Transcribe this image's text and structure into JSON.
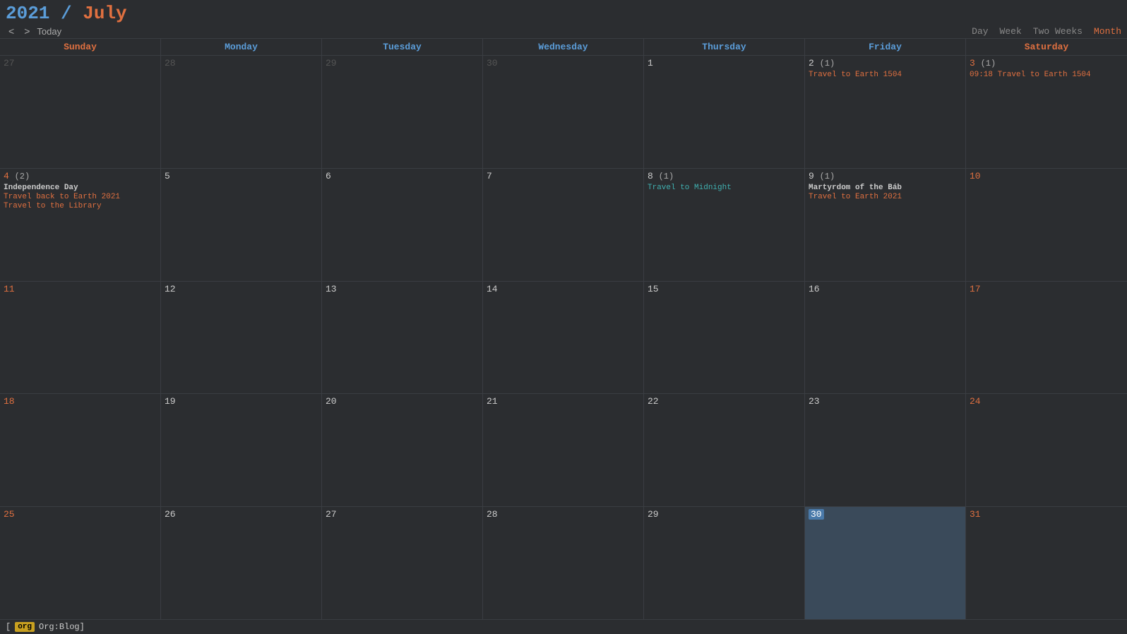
{
  "header": {
    "year": "2021",
    "slash": " / ",
    "month": "July",
    "nav": {
      "prev": "<",
      "next": ">",
      "today": "Today"
    },
    "views": [
      "Day",
      "Week",
      "Two Weeks",
      "Month"
    ],
    "active_view": "Month"
  },
  "day_headers": [
    {
      "label": "Sunday",
      "type": "weekend"
    },
    {
      "label": "Monday",
      "type": "weekday"
    },
    {
      "label": "Tuesday",
      "type": "weekday"
    },
    {
      "label": "Wednesday",
      "type": "weekday"
    },
    {
      "label": "Thursday",
      "type": "weekday"
    },
    {
      "label": "Friday",
      "type": "weekday"
    },
    {
      "label": "Saturday",
      "type": "weekend"
    }
  ],
  "weeks": [
    {
      "days": [
        {
          "num": "27",
          "other": true,
          "events": []
        },
        {
          "num": "28",
          "other": true,
          "events": []
        },
        {
          "num": "29",
          "other": true,
          "events": []
        },
        {
          "num": "30",
          "other": true,
          "events": []
        },
        {
          "num": "1",
          "other": false,
          "events": []
        },
        {
          "num": "2",
          "other": false,
          "count": "(1)",
          "events": [
            {
              "text": "Travel to Earth 1504",
              "style": "orange"
            }
          ]
        },
        {
          "num": "3",
          "other": false,
          "weekend": true,
          "count": "(1)",
          "events": [
            {
              "text": "09:18 Travel to Earth 1504",
              "style": "orange"
            }
          ]
        }
      ]
    },
    {
      "days": [
        {
          "num": "4",
          "other": false,
          "weekend": true,
          "count": "(2)",
          "events": [
            {
              "text": "Independence Day",
              "style": "bold"
            },
            {
              "text": "Travel back to Earth 2021",
              "style": "orange"
            },
            {
              "text": "Travel to the Library",
              "style": "orange"
            }
          ]
        },
        {
          "num": "5",
          "other": false,
          "events": []
        },
        {
          "num": "6",
          "other": false,
          "events": []
        },
        {
          "num": "7",
          "other": false,
          "events": []
        },
        {
          "num": "8",
          "other": false,
          "count": "(1)",
          "events": [
            {
              "text": "Travel to Midnight",
              "style": "cyan"
            }
          ]
        },
        {
          "num": "9",
          "other": false,
          "count": "(1)",
          "events": [
            {
              "text": "Martyrdom of the Báb",
              "style": "bold"
            },
            {
              "text": "Travel to Earth 2021",
              "style": "orange"
            }
          ]
        },
        {
          "num": "10",
          "other": false,
          "weekend": true,
          "events": []
        }
      ]
    },
    {
      "days": [
        {
          "num": "11",
          "other": false,
          "weekend": true,
          "events": []
        },
        {
          "num": "12",
          "other": false,
          "events": []
        },
        {
          "num": "13",
          "other": false,
          "events": []
        },
        {
          "num": "14",
          "other": false,
          "events": []
        },
        {
          "num": "15",
          "other": false,
          "events": []
        },
        {
          "num": "16",
          "other": false,
          "events": []
        },
        {
          "num": "17",
          "other": false,
          "weekend": true,
          "events": []
        }
      ]
    },
    {
      "days": [
        {
          "num": "18",
          "other": false,
          "weekend": true,
          "events": []
        },
        {
          "num": "19",
          "other": false,
          "events": []
        },
        {
          "num": "20",
          "other": false,
          "events": []
        },
        {
          "num": "21",
          "other": false,
          "events": []
        },
        {
          "num": "22",
          "other": false,
          "events": []
        },
        {
          "num": "23",
          "other": false,
          "events": []
        },
        {
          "num": "24",
          "other": false,
          "weekend": true,
          "events": []
        }
      ]
    },
    {
      "days": [
        {
          "num": "25",
          "other": false,
          "weekend": true,
          "events": []
        },
        {
          "num": "26",
          "other": false,
          "events": []
        },
        {
          "num": "27",
          "other": false,
          "events": []
        },
        {
          "num": "28",
          "other": false,
          "events": []
        },
        {
          "num": "29",
          "other": false,
          "events": []
        },
        {
          "num": "30",
          "other": false,
          "today": true,
          "events": []
        },
        {
          "num": "31",
          "other": false,
          "weekend": true,
          "events": []
        }
      ]
    }
  ],
  "bottom_bar": {
    "tag": "org",
    "label": "Org:Blog]"
  }
}
